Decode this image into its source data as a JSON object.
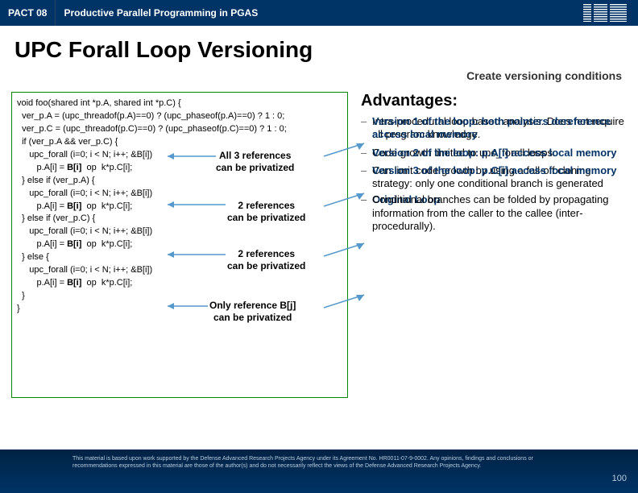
{
  "header": {
    "left": "PACT 08",
    "title": "Productive Parallel Programming in PGAS"
  },
  "title": "UPC Forall Loop Versioning",
  "subhead": "Create versioning conditions",
  "code": {
    "l0": "void foo(shared int *p.A, shared int *p.C) {",
    "l1": "  ver_p.A = (upc_threadof(p.A)==0) ? (upc_phaseof(p.A)==0) ? 1 : 0;",
    "l2": "  ver_p.C = (upc_threadof(p.C)==0) ? (upc_phaseof(p.C)==0) ? 1 : 0;",
    "l3": "  if (ver_p.A && ver_p.C) {",
    "l4a": "     upc_forall (i=0; i < N; i++; &B[i])",
    "l5a": "        p.A[i] = ",
    "l5b": "B[i]",
    "l5c": "  op  k*p.C[i];",
    "l6": "  } else if (ver_p.A) {",
    "l7a": "     upc_forall (i=0; i < N; i++; &B[i])",
    "l8a": "        p.A[i] = ",
    "l8b": "B[i]",
    "l8c": "  op  k*p.C[i];",
    "l9": "  } else if (ver_p.C) {",
    "l10a": "     upc_forall (i=0; i < N; i++; &B[i])",
    "l11a": "        p.A[i] = ",
    "l11b": "B[i]",
    "l11c": "  op  k*p.C[i];",
    "l12": "  } else {",
    "l13a": "     upc_forall (i=0; i < N; i++; &B[i])",
    "l14a": "        p.A[i] = ",
    "l14b": "B[i]",
    "l14c": "  op  k*p.C[i];",
    "l15": "  }",
    "l16": "}"
  },
  "annot": {
    "a1a": "All 3 references",
    "a1b": "can be privatized",
    "a2a": "2 references",
    "a2b": "can be privatized",
    "a3a": "2 references",
    "a3b": "can be privatized",
    "a4a": "Only reference B[j]",
    "a4b": "can be privatized"
  },
  "adv": {
    "title": "Advantages:",
    "i1_over": "Version 1 of the loop: both pointers dereference access local memory",
    "i1_main": "Intra-procedural loop based analysis. Does not require all program knowledge.",
    "i2_over": "Version 2 of the loop: p.A[i] access local memory",
    "i2_main": "Code growth limited to upc_forall loops.",
    "i3_over": "Version 3 of the loop: p.C[i] access local memory",
    "i3_main": "Can limit code growth by using a fall-off cloning strategy: only one conditional branch is generated",
    "i4_over": "Original Loop",
    "i4_main": "Conditional branches can be folded by propagating information from the caller to the callee (inter-procedurally)."
  },
  "footer": {
    "text": "This material is based upon work supported by the Defense Advanced Research Projects Agency under its Agreement No. HR0011-07-9-0002. Any opinions, findings and conclusions or recommendations expressed in this material are those of the author(s) and do not necessarily reflect the views of the Defense Advanced Research Projects Agency.",
    "page": "100"
  }
}
